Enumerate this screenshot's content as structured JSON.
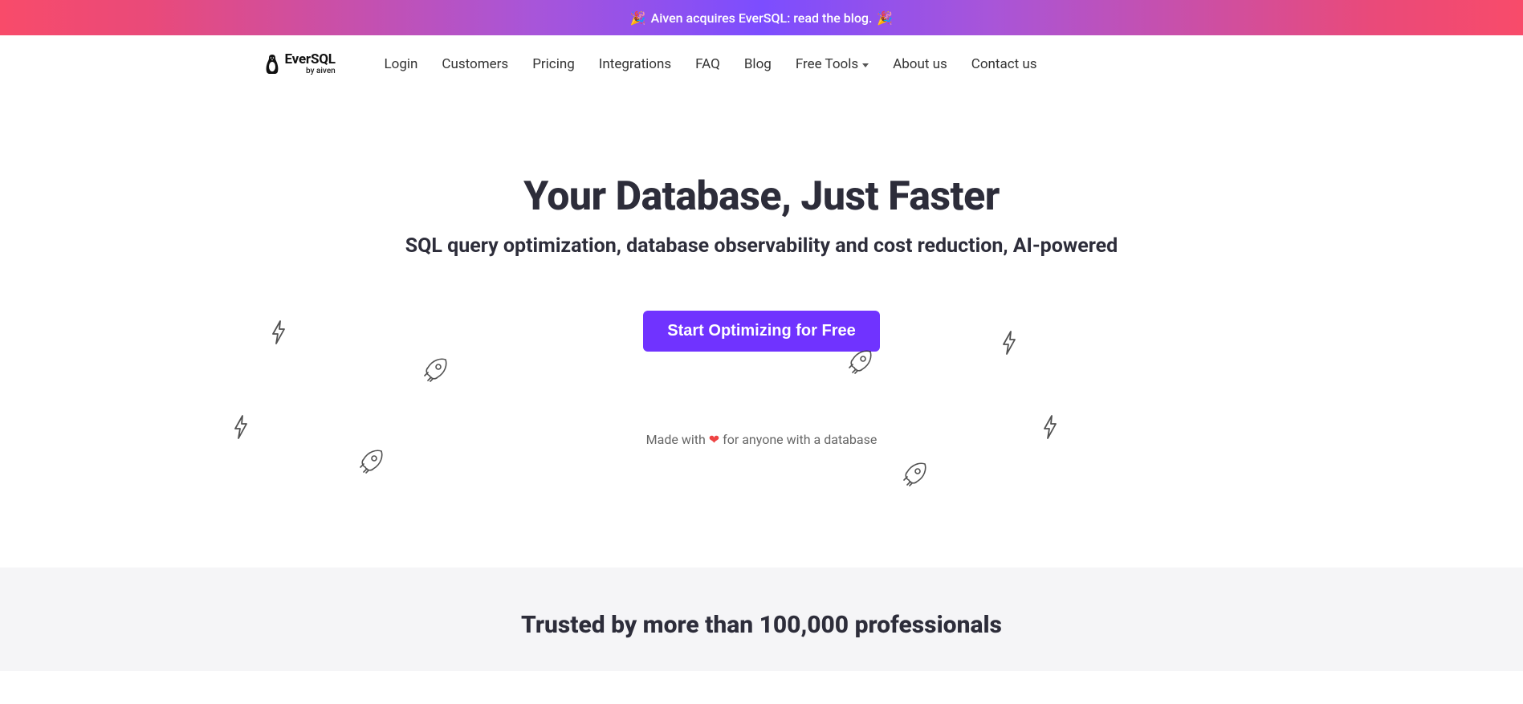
{
  "announcement": {
    "text": "Aiven acquires EverSQL: read the blog."
  },
  "logo": {
    "name": "EverSQL",
    "byline": "by aiven"
  },
  "nav": {
    "login": "Login",
    "customers": "Customers",
    "pricing": "Pricing",
    "integrations": "Integrations",
    "faq": "FAQ",
    "blog": "Blog",
    "free_tools": "Free Tools",
    "about": "About us",
    "contact": "Contact us"
  },
  "hero": {
    "title": "Your Database, Just Faster",
    "subtitle": "SQL query optimization, database observability and cost reduction, AI-powered",
    "cta": "Start Optimizing for Free",
    "made_with_pre": "Made with ",
    "made_with_post": "  for anyone with a database"
  },
  "trusted": {
    "title": "Trusted by more than 100,000 professionals"
  }
}
